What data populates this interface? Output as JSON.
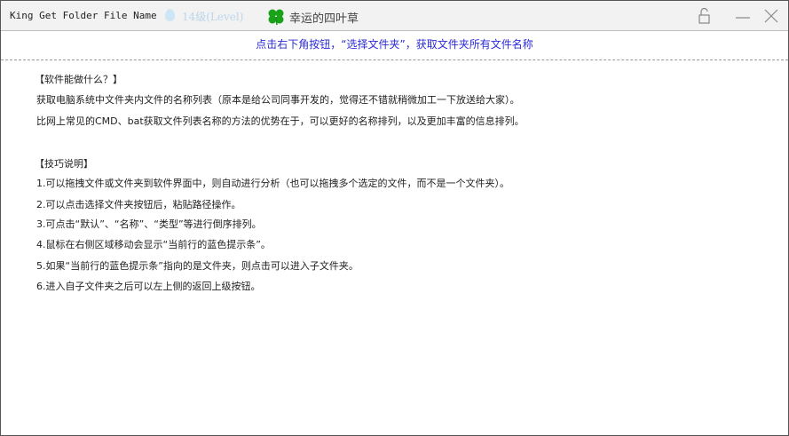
{
  "titlebar": {
    "app_title": "King Get Folder File Name",
    "level": "14级(Level)",
    "username": "幸运的四叶草"
  },
  "hint": "点击右下角按钮，“选择文件夹”，获取文件夹所有文件名称",
  "section1": {
    "heading": "【软件能做什么？】",
    "lines": [
      "获取电脑系统中文件夹内文件的名称列表（原本是给公司同事开发的，觉得还不错就稍微加工一下放送给大家）。",
      "比网上常见的CMD、bat获取文件列表名称的方法的优势在于，可以更好的名称排列，以及更加丰富的信息排列。"
    ]
  },
  "section2": {
    "heading": "【技巧说明】",
    "lines": [
      "1.可以拖拽文件或文件夹到软件界面中，则自动进行分析（也可以拖拽多个选定的文件，而不是一个文件夹）。",
      "2.可以点击选择文件夹按钮后，粘贴路径操作。",
      "3.可点击“默认”、“名称”、“类型”等进行倒序排列。",
      "4.鼠标在右侧区域移动会显示“当前行的蓝色提示条”。",
      "5.如果“当前行的蓝色提示条”指向的是文件夹，则点击可以进入子文件夹。",
      "6.进入自子文件夹之后可以左上侧的返回上级按钮。"
    ]
  }
}
